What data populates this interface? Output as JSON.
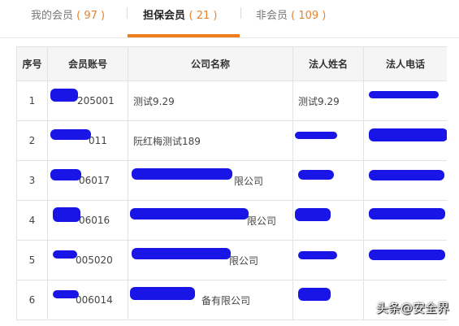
{
  "tabs": [
    {
      "label": "我的会员",
      "count_text": "( 97 )",
      "active": false
    },
    {
      "label": "担保会员",
      "count_text": "( 21 )",
      "active": true
    },
    {
      "label": "非会员",
      "count_text": "( 109 )",
      "active": false
    }
  ],
  "table": {
    "headers": [
      "序号",
      "会员账号",
      "公司名称",
      "法人姓名",
      "法人电话"
    ],
    "rows": [
      {
        "no": "1",
        "account": "205001",
        "company": "测试9.29",
        "legal_name": "测试9.29",
        "phone": ""
      },
      {
        "no": "2",
        "account": "011",
        "company": "阮红梅测试189",
        "legal_name": "",
        "phone": ""
      },
      {
        "no": "3",
        "account": "06017",
        "company": "限公司",
        "legal_name": "",
        "phone": ""
      },
      {
        "no": "4",
        "account": "06016",
        "company": "限公司",
        "legal_name": "",
        "phone": ""
      },
      {
        "no": "5",
        "account": "005020",
        "company": "限公司",
        "legal_name": "",
        "phone": ""
      },
      {
        "no": "6",
        "account": "006014",
        "company": "备有限公司",
        "legal_name": "",
        "phone": ""
      }
    ]
  },
  "watermark": "头条@安全界"
}
